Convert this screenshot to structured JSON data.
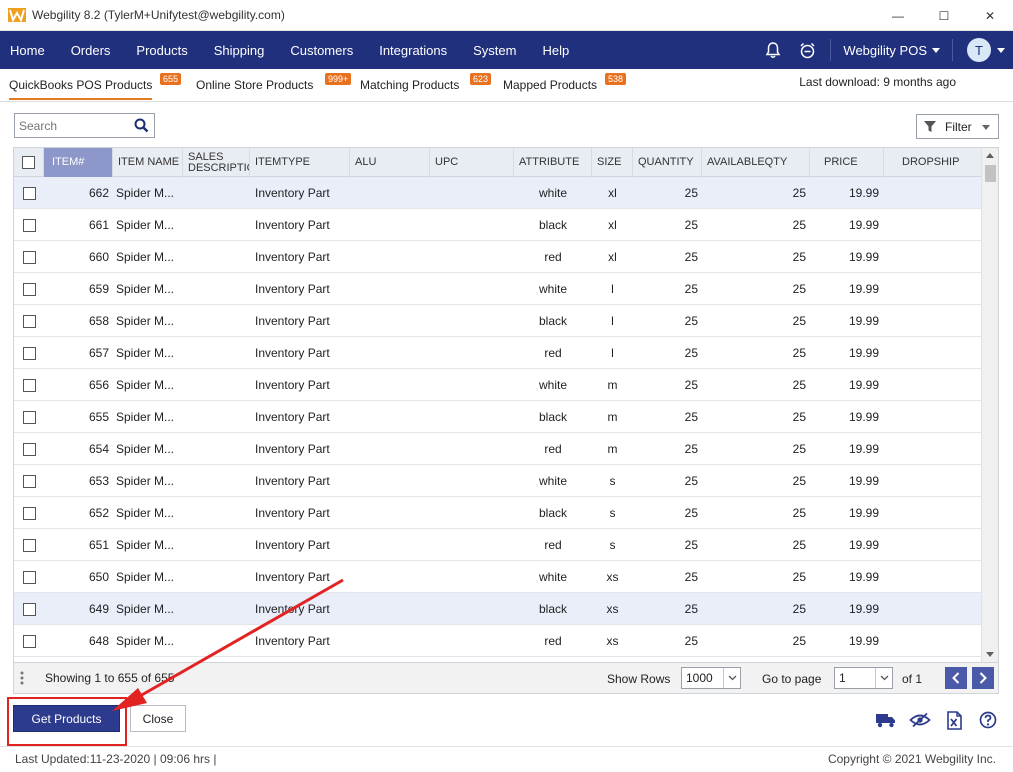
{
  "window": {
    "title": "Webgility 8.2 (TylerM+Unifytest@webgility.com)",
    "minimize_glyph": "—",
    "maximize_glyph": "☐",
    "close_glyph": "✕"
  },
  "nav": {
    "items": [
      "Home",
      "Orders",
      "Products",
      "Shipping",
      "Customers",
      "Integrations",
      "System",
      "Help"
    ],
    "company": "Webgility POS",
    "avatar_initial": "T"
  },
  "subtabs": [
    {
      "label": "QuickBooks POS Products",
      "badge": "655"
    },
    {
      "label": "Online Store Products",
      "badge": "999+"
    },
    {
      "label": "Matching Products",
      "badge": "623"
    },
    {
      "label": "Mapped Products",
      "badge": "538"
    }
  ],
  "last_download": "Last download: 9 months ago",
  "search": {
    "placeholder": "Search",
    "value": "Search"
  },
  "filter_label": "Filter",
  "table": {
    "columns": [
      {
        "key": "item",
        "label": "ITEM#"
      },
      {
        "key": "name",
        "label": "ITEM NAME"
      },
      {
        "key": "desc",
        "label": "SALES DESCRIPTION"
      },
      {
        "key": "type",
        "label": "ITEMTYPE"
      },
      {
        "key": "alu",
        "label": "ALU"
      },
      {
        "key": "upc",
        "label": "UPC"
      },
      {
        "key": "attr",
        "label": "ATTRIBUTE"
      },
      {
        "key": "size",
        "label": "SIZE"
      },
      {
        "key": "qty",
        "label": "QUANTITY"
      },
      {
        "key": "avail",
        "label": "AVAILABLEQTY"
      },
      {
        "key": "price",
        "label": "PRICE"
      },
      {
        "key": "drop",
        "label": "DROPSHIP"
      }
    ],
    "rows": [
      {
        "item": "662",
        "name": "Spider M...",
        "type": "Inventory Part",
        "attr": "white",
        "size": "xl",
        "qty": "25",
        "avail": "25",
        "price": "19.99"
      },
      {
        "item": "661",
        "name": "Spider M...",
        "type": "Inventory Part",
        "attr": "black",
        "size": "xl",
        "qty": "25",
        "avail": "25",
        "price": "19.99"
      },
      {
        "item": "660",
        "name": "Spider M...",
        "type": "Inventory Part",
        "attr": "red",
        "size": "xl",
        "qty": "25",
        "avail": "25",
        "price": "19.99"
      },
      {
        "item": "659",
        "name": "Spider M...",
        "type": "Inventory Part",
        "attr": "white",
        "size": "l",
        "qty": "25",
        "avail": "25",
        "price": "19.99"
      },
      {
        "item": "658",
        "name": "Spider M...",
        "type": "Inventory Part",
        "attr": "black",
        "size": "l",
        "qty": "25",
        "avail": "25",
        "price": "19.99"
      },
      {
        "item": "657",
        "name": "Spider M...",
        "type": "Inventory Part",
        "attr": "red",
        "size": "l",
        "qty": "25",
        "avail": "25",
        "price": "19.99"
      },
      {
        "item": "656",
        "name": "Spider M...",
        "type": "Inventory Part",
        "attr": "white",
        "size": "m",
        "qty": "25",
        "avail": "25",
        "price": "19.99"
      },
      {
        "item": "655",
        "name": "Spider M...",
        "type": "Inventory Part",
        "attr": "black",
        "size": "m",
        "qty": "25",
        "avail": "25",
        "price": "19.99"
      },
      {
        "item": "654",
        "name": "Spider M...",
        "type": "Inventory Part",
        "attr": "red",
        "size": "m",
        "qty": "25",
        "avail": "25",
        "price": "19.99"
      },
      {
        "item": "653",
        "name": "Spider M...",
        "type": "Inventory Part",
        "attr": "white",
        "size": "s",
        "qty": "25",
        "avail": "25",
        "price": "19.99"
      },
      {
        "item": "652",
        "name": "Spider M...",
        "type": "Inventory Part",
        "attr": "black",
        "size": "s",
        "qty": "25",
        "avail": "25",
        "price": "19.99"
      },
      {
        "item": "651",
        "name": "Spider M...",
        "type": "Inventory Part",
        "attr": "red",
        "size": "s",
        "qty": "25",
        "avail": "25",
        "price": "19.99"
      },
      {
        "item": "650",
        "name": "Spider M...",
        "type": "Inventory Part",
        "attr": "white",
        "size": "xs",
        "qty": "25",
        "avail": "25",
        "price": "19.99"
      },
      {
        "item": "649",
        "name": "Spider M...",
        "type": "Inventory Part",
        "attr": "black",
        "size": "xs",
        "qty": "25",
        "avail": "25",
        "price": "19.99"
      },
      {
        "item": "648",
        "name": "Spider M...",
        "type": "Inventory Part",
        "attr": "red",
        "size": "xs",
        "qty": "25",
        "avail": "25",
        "price": "19.99"
      }
    ]
  },
  "pager": {
    "showing": "Showing 1 to 655 of 655",
    "show_rows_label": "Show Rows",
    "show_rows_value": "1000",
    "goto_label": "Go to page",
    "page_value": "1",
    "of_label": "of 1"
  },
  "buttons": {
    "get_products": "Get Products",
    "close": "Close"
  },
  "status": {
    "last_updated": "Last Updated:11-23-2020 | 09:06 hrs |",
    "copyright": "Copyright © 2021 Webgility Inc."
  },
  "colors": {
    "nav_bg": "#21307d",
    "accent_orange": "#e8711f",
    "primary_button": "#2c3b8d",
    "annotation_red": "#e32222"
  }
}
